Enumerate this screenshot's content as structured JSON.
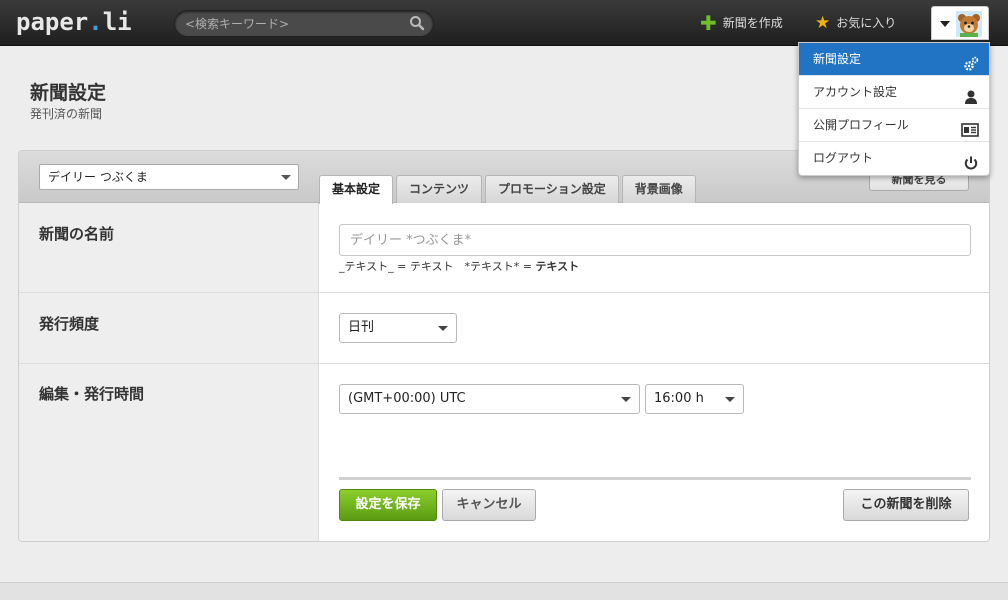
{
  "header": {
    "logo_main": "paper",
    "logo_dot": ".",
    "logo_end": "li",
    "search_placeholder": "<検索キーワード>",
    "create_label": "新聞を作成",
    "favorites_label": "お気に入り"
  },
  "dropdown": {
    "items": [
      {
        "label": "新聞設定",
        "icon": "gears-icon"
      },
      {
        "label": "アカウント設定",
        "icon": "person-icon"
      },
      {
        "label": "公開プロフィール",
        "icon": "id-card-icon"
      },
      {
        "label": "ログアウト",
        "icon": "power-icon"
      }
    ]
  },
  "page": {
    "title": "新聞設定",
    "subtitle": "発刊済の新聞"
  },
  "panel": {
    "paper_select": "デイリー つぶくま",
    "tabs": [
      "基本設定",
      "コンテンツ",
      "プロモーション設定",
      "背景画像"
    ],
    "view_paper": "新聞を見る"
  },
  "form": {
    "name_label": "新聞の名前",
    "name_placeholder": "デイリー *つぶくま*",
    "hint_plain": "_テキスト_ = テキスト　*テキスト* = ",
    "hint_bold": "テキスト",
    "frequency_label": "発行頻度",
    "frequency_value": "日刊",
    "time_label": "編集・発行時間",
    "timezone_value": "(GMT+00:00) UTC",
    "time_value": "16:00 h"
  },
  "buttons": {
    "save": "設定を保存",
    "cancel": "キャンセル",
    "delete": "この新聞を削除"
  },
  "colors": {
    "accent_blue": "#2174c4",
    "save_green": "#6fb31d",
    "plus_green": "#6fbf2a",
    "star_gold": "#f0b400"
  }
}
